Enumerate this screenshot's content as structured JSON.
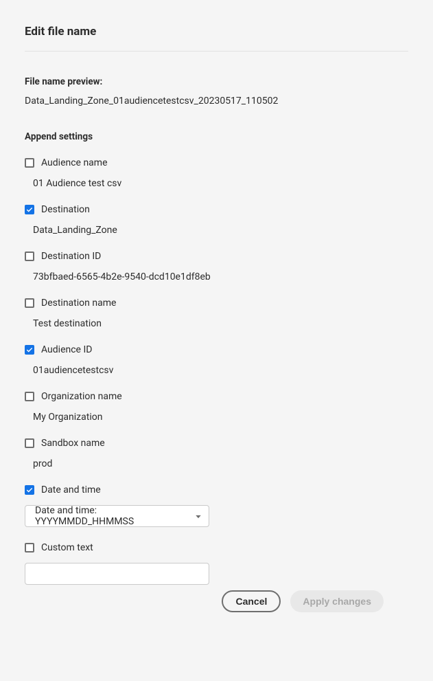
{
  "title": "Edit file name",
  "preview": {
    "label": "File name preview:",
    "value": "Data_Landing_Zone_01audiencetestcsv_20230517_110502"
  },
  "append": {
    "heading": "Append settings",
    "items": [
      {
        "key": "audience-name",
        "label": "Audience name",
        "value": "01 Audience test csv",
        "checked": false,
        "control": "text"
      },
      {
        "key": "destination",
        "label": "Destination",
        "value": "Data_Landing_Zone",
        "checked": true,
        "control": "text"
      },
      {
        "key": "destination-id",
        "label": "Destination ID",
        "value": "73bfbaed-6565-4b2e-9540-dcd10e1df8eb",
        "checked": false,
        "control": "text"
      },
      {
        "key": "destination-name",
        "label": "Destination name",
        "value": "Test destination",
        "checked": false,
        "control": "text"
      },
      {
        "key": "audience-id",
        "label": "Audience ID",
        "value": "01audiencetestcsv",
        "checked": true,
        "control": "text"
      },
      {
        "key": "organization-name",
        "label": "Organization name",
        "value": "My Organization",
        "checked": false,
        "control": "text"
      },
      {
        "key": "sandbox-name",
        "label": "Sandbox name",
        "value": "prod",
        "checked": false,
        "control": "text"
      },
      {
        "key": "date-and-time",
        "label": "Date and time",
        "value": "Date and time: YYYYMMDD_HHMMSS",
        "checked": true,
        "control": "select"
      },
      {
        "key": "custom-text",
        "label": "Custom text",
        "value": "",
        "checked": false,
        "control": "input"
      }
    ]
  },
  "buttons": {
    "cancel": "Cancel",
    "apply": "Apply changes"
  }
}
